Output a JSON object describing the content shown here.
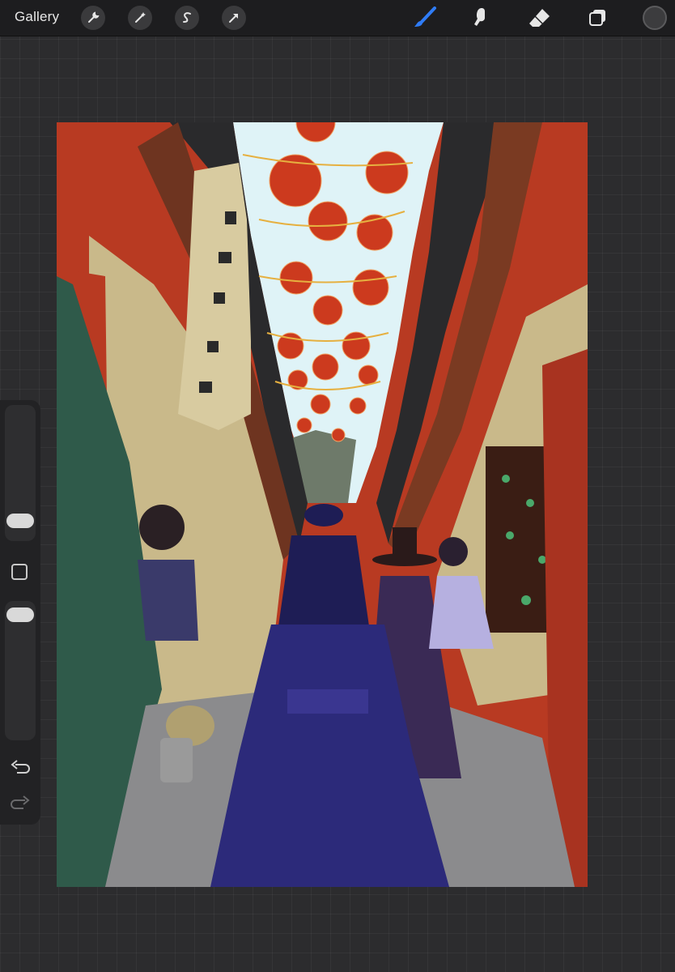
{
  "toolbar": {
    "gallery_label": "Gallery",
    "left_tools": [
      {
        "name": "wrench-icon"
      },
      {
        "name": "magic-wand-icon"
      },
      {
        "name": "selection-s-icon"
      },
      {
        "name": "transform-arrow-icon"
      }
    ],
    "right_tools": [
      {
        "name": "brush-icon",
        "active": true
      },
      {
        "name": "smudge-icon"
      },
      {
        "name": "eraser-icon"
      },
      {
        "name": "layers-icon"
      }
    ],
    "accent_color": "#2f7cf6",
    "current_color": "#3c3c3e"
  },
  "sidebar": {
    "brush_size_slider_icon": "slider-handle",
    "opacity_slider_icon": "slider-handle",
    "modify_icon": "square-icon",
    "undo_icon": "undo-icon",
    "redo_icon": "redo-icon"
  },
  "artwork": {
    "subject": "artwork-market-alley",
    "colors": {
      "sky": "#dff3f7",
      "lantern": "#cc3a1e",
      "wall": "#c9b98a",
      "wood": "#8a3520",
      "robe": "#2c2a7a"
    }
  }
}
